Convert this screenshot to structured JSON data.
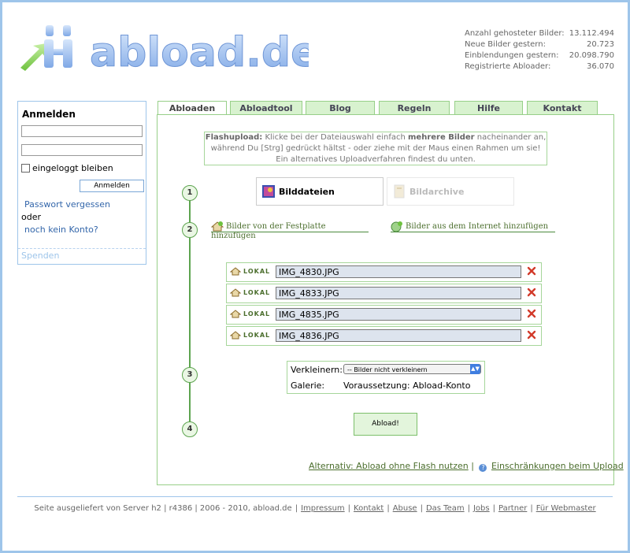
{
  "logo": {
    "text": "abload.de"
  },
  "stats": [
    {
      "label": "Anzahl gehosteter Bilder:",
      "value": "13.112.494"
    },
    {
      "label": "Neue Bilder gestern:",
      "value": "20.723"
    },
    {
      "label": "Einblendungen gestern:",
      "value": "20.098.790"
    },
    {
      "label": "Registrierte Abloader:",
      "value": "36.070"
    }
  ],
  "login": {
    "title": "Anmelden",
    "remember": "eingeloggt bleiben",
    "button": "Anmelden",
    "forgot": "Passwort vergessen",
    "or": "oder",
    "register": "noch kein Konto?",
    "donate": "Spenden"
  },
  "tabs": [
    "Abloaden",
    "Abloadtool",
    "Blog",
    "Regeln",
    "Hilfe",
    "Kontakt"
  ],
  "notice": {
    "bold1": "Flashupload:",
    "text1": " Klicke bei der Dateiauswahl einfach ",
    "bold2": "mehrere Bilder",
    "text2": " nacheinander an, während Du [Strg] gedrückt hältst - oder ziehe mit der Maus einen Rahmen um sie! Ein alternatives Uploadverfahren findest du unten."
  },
  "steps": [
    "1",
    "2",
    "3",
    "4"
  ],
  "source": {
    "images": "Bilddateien",
    "archives": "Bildarchive"
  },
  "add": {
    "local": "Bilder von der Festplatte hinzufügen",
    "web": "Bilder aus dem Internet hinzufügen"
  },
  "files": [
    {
      "tag": "LOKAL",
      "name": "IMG_4830.JPG"
    },
    {
      "tag": "LOKAL",
      "name": "IMG_4833.JPG"
    },
    {
      "tag": "LOKAL",
      "name": "IMG_4835.JPG"
    },
    {
      "tag": "LOKAL",
      "name": "IMG_4836.JPG"
    }
  ],
  "options": {
    "resize_label": "Verkleinern:",
    "resize_value": "-- Bilder nicht verkleinern",
    "gallery_label": "Galerie:",
    "gallery_value": "Voraussetzung: Abload-Konto"
  },
  "upload_button": "Abload!",
  "alt": {
    "noflash": "Alternativ: Abload ohne Flash nutzen",
    "sep": "|",
    "limits": "Einschränkungen beim Upload"
  },
  "footer": {
    "text": "Seite ausgeliefert von Server h2 | r4386 | 2006 - 2010, abload.de",
    "links": [
      "Impressum",
      "Kontakt",
      "Abuse",
      "Das Team",
      "Jobs",
      "Partner",
      "Für Webmaster"
    ]
  },
  "colors": {
    "green": "#5da44f",
    "blue_frame": "#9ec5ea",
    "tab_bg": "#d8f2cf"
  }
}
